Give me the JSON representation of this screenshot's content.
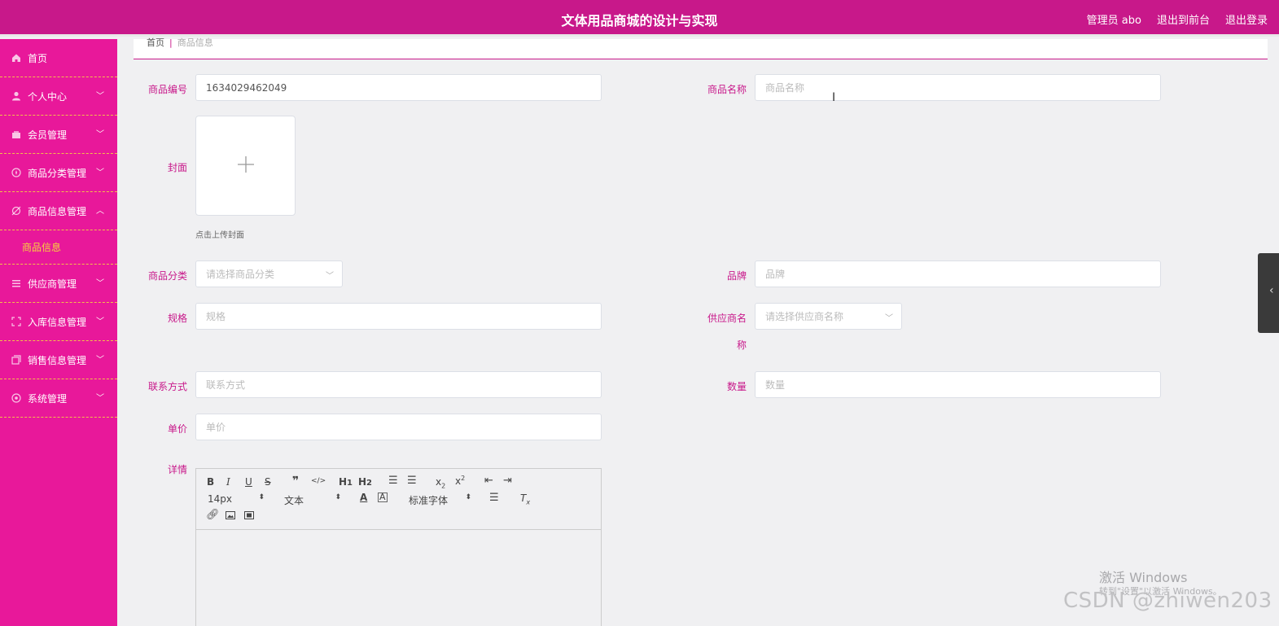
{
  "header": {
    "title": "文体用品商城的设计与实现",
    "user_label": "管理员 abo",
    "to_front": "退出到前台",
    "logout": "退出登录"
  },
  "sidebar": {
    "items": [
      {
        "label": "首页",
        "icon": "home-icon"
      },
      {
        "label": "个人中心",
        "icon": "user-icon"
      },
      {
        "label": "会员管理",
        "icon": "members-icon"
      },
      {
        "label": "商品分类管理",
        "icon": "category-icon"
      },
      {
        "label": "商品信息管理",
        "icon": "goods-icon"
      },
      {
        "label": "供应商管理",
        "icon": "list-icon"
      },
      {
        "label": "入库信息管理",
        "icon": "stock-in-icon"
      },
      {
        "label": "销售信息管理",
        "icon": "sales-icon"
      },
      {
        "label": "系统管理",
        "icon": "system-icon"
      }
    ],
    "submenu_active": "商品信息"
  },
  "breadcrumb": {
    "home": "首页",
    "separator": "|",
    "current": "商品信息"
  },
  "form": {
    "goods_no_label": "商品编号",
    "goods_no_value": "1634029462049",
    "goods_name_label": "商品名称",
    "goods_name_placeholder": "商品名称",
    "cover_label": "封面",
    "cover_tip": "点击上传封面",
    "category_label": "商品分类",
    "category_placeholder": "请选择商品分类",
    "brand_label": "品牌",
    "brand_placeholder": "品牌",
    "spec_label": "规格",
    "spec_placeholder": "规格",
    "supplier_label_1": "供应商名",
    "supplier_label_2": "称",
    "supplier_placeholder": "请选择供应商名称",
    "contact_label": "联系方式",
    "contact_placeholder": "联系方式",
    "qty_label": "数量",
    "qty_placeholder": "数量",
    "price_label": "单价",
    "price_placeholder": "单价",
    "detail_label": "详情"
  },
  "editor": {
    "font_size": "14px",
    "block_format": "文本",
    "font_family": "标准字体",
    "buttons": [
      "B",
      "I",
      "U",
      "S",
      "❞",
      "</>",
      "H1",
      "H2",
      "ol",
      "ul",
      "x₂",
      "x²",
      "outdent",
      "indent",
      "color",
      "background",
      "align",
      "clear",
      "link",
      "image",
      "video"
    ]
  },
  "watermark": {
    "activate": "激活 Windows",
    "activate_sub": "转到\"设置\"以激活 Windows。",
    "csdn": "CSDN @zhiwen203"
  }
}
